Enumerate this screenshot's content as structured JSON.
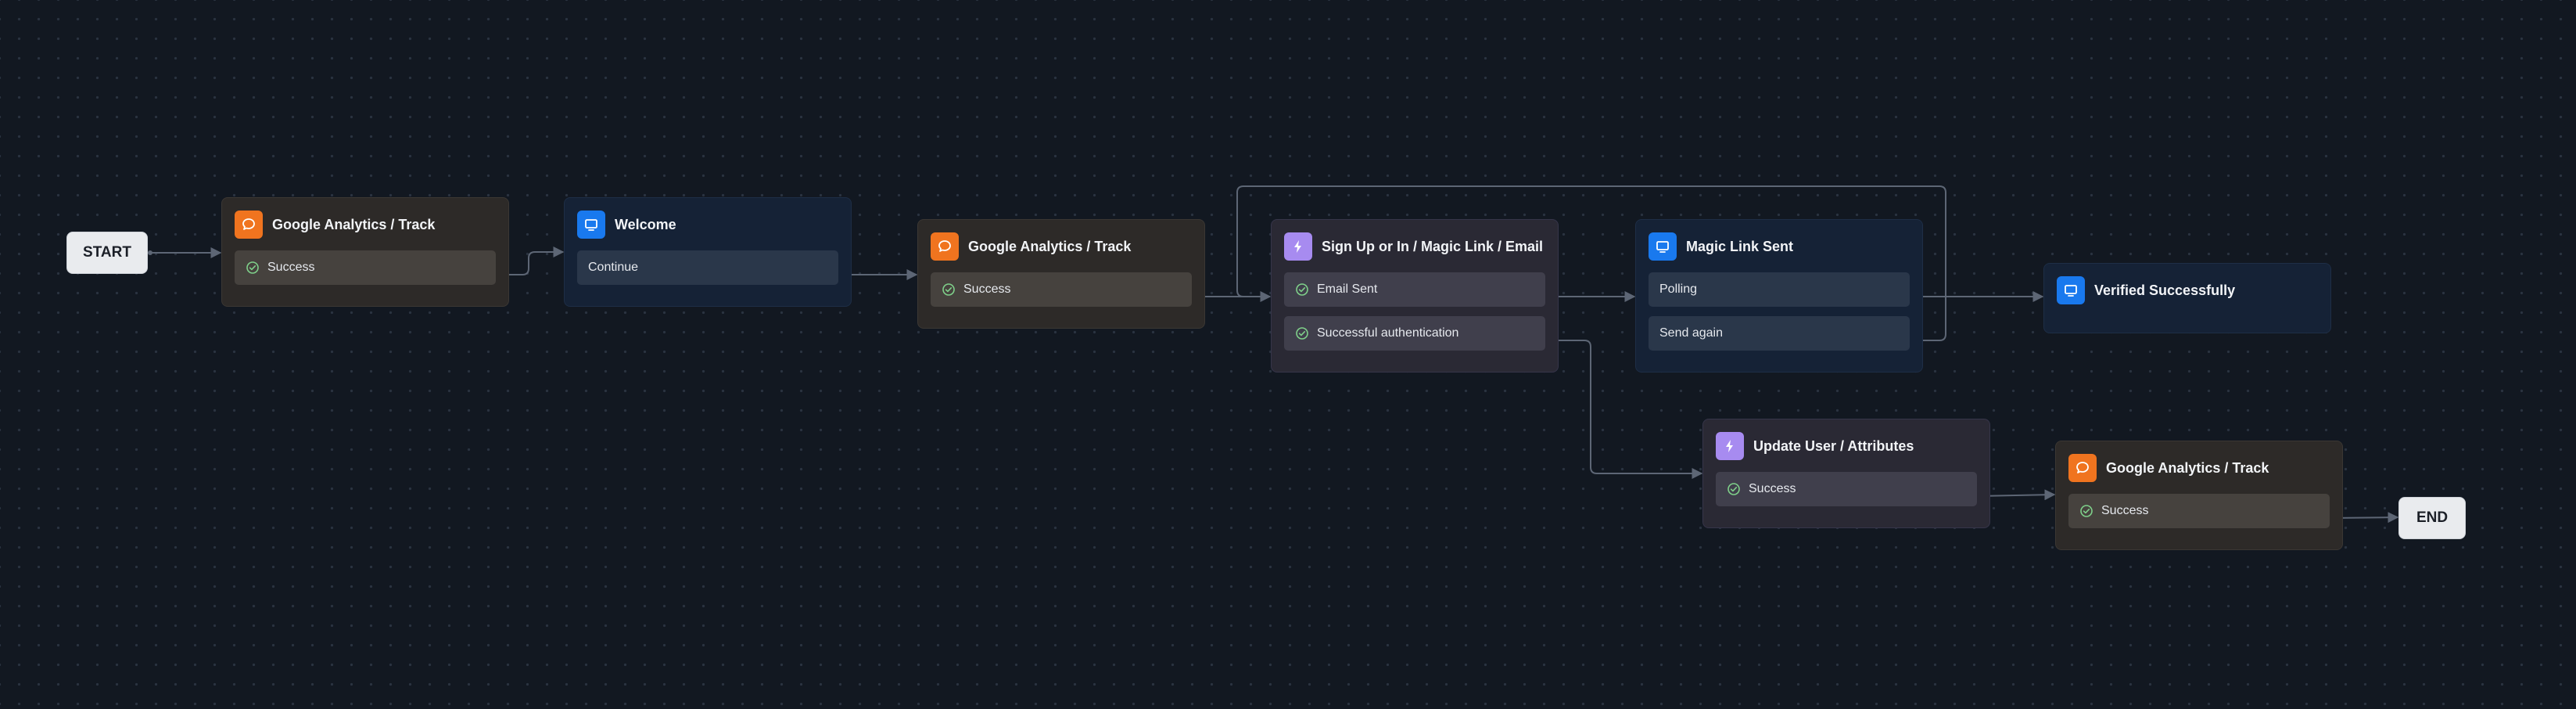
{
  "colors": {
    "background": "#121821",
    "edge": "#5d6675",
    "analytics_accent": "#f0741f",
    "screen_accent": "#1979ee",
    "action_accent": "#a78bf0",
    "success_check": "#7fd08a"
  },
  "terminals": {
    "start": "START",
    "end": "END"
  },
  "nodes": {
    "ga1": {
      "kind": "analytics",
      "icon": "chat-bubble-icon",
      "title": "Google Analytics / Track",
      "ports": [
        {
          "label": "Success",
          "icon": "check-circle-icon"
        }
      ]
    },
    "welcome": {
      "kind": "screen",
      "icon": "monitor-icon",
      "title": "Welcome",
      "ports": [
        {
          "label": "Continue",
          "icon": ""
        }
      ]
    },
    "ga2": {
      "kind": "analytics",
      "icon": "chat-bubble-icon",
      "title": "Google Analytics / Track",
      "ports": [
        {
          "label": "Success",
          "icon": "check-circle-icon"
        }
      ]
    },
    "signup": {
      "kind": "action",
      "icon": "lightning-icon",
      "title": "Sign Up or In / Magic Link / Email",
      "ports": [
        {
          "label": "Email Sent",
          "icon": "check-circle-icon"
        },
        {
          "label": "Successful authentication",
          "icon": "check-circle-icon"
        }
      ]
    },
    "magiclink": {
      "kind": "screen",
      "icon": "monitor-icon",
      "title": "Magic Link Sent",
      "ports": [
        {
          "label": "Polling",
          "icon": ""
        },
        {
          "label": "Send again",
          "icon": ""
        }
      ]
    },
    "verified": {
      "kind": "screen",
      "icon": "monitor-icon",
      "title": "Verified Successfully",
      "ports": []
    },
    "update": {
      "kind": "action",
      "icon": "lightning-icon",
      "title": "Update User / Attributes",
      "ports": [
        {
          "label": "Success",
          "icon": "check-circle-icon"
        }
      ]
    },
    "ga3": {
      "kind": "analytics",
      "icon": "chat-bubble-icon",
      "title": "Google Analytics / Track",
      "ports": [
        {
          "label": "Success",
          "icon": "check-circle-icon"
        }
      ]
    }
  },
  "edges": [
    {
      "from": "start",
      "to": "ga1"
    },
    {
      "from": "ga1.Success",
      "to": "welcome"
    },
    {
      "from": "welcome.Continue",
      "to": "ga2"
    },
    {
      "from": "ga2.Success",
      "to": "signup"
    },
    {
      "from": "signup.Email Sent",
      "to": "magiclink"
    },
    {
      "from": "signup.Successful authentication",
      "to": "update"
    },
    {
      "from": "magiclink.Polling",
      "to": "verified"
    },
    {
      "from": "magiclink.Send again",
      "to": "signup"
    },
    {
      "from": "update.Success",
      "to": "ga3"
    },
    {
      "from": "ga3.Success",
      "to": "end"
    }
  ]
}
